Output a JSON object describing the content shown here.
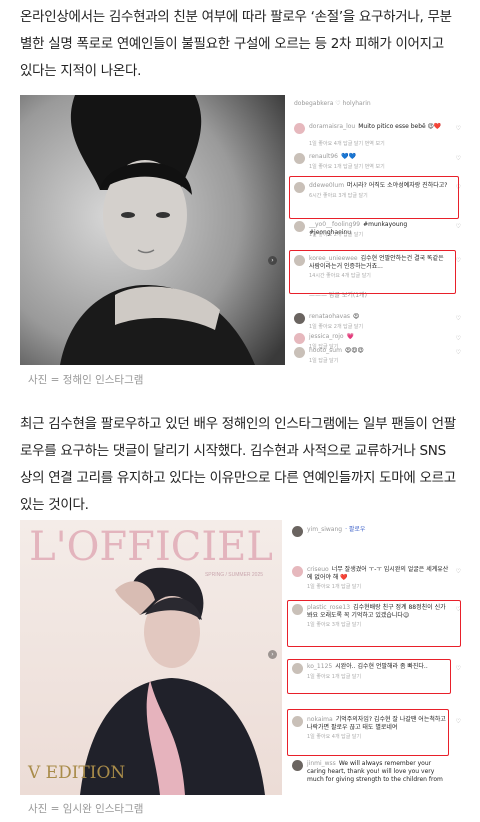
{
  "article": {
    "para1": "온라인상에서는 김수현과의 친분 여부에 따라 팔로우 ‘손절’을 요구하거나, 무분별한 실명 폭로로 연예인들이 불필요한 구설에 오르는 등 2차 피해가 이어지고 있다는 지적이 나온다.",
    "para2": "최근 김수현을 팔로우하고 있던 배우 정해인의 인스타그램에는 일부 팬들이 언팔로우를 요구하는 댓글이 달리기 시작했다. 김수현과 사적으로 교류하거나 SNS 상의 연결 고리를 유지하고 있다는 이유만으로 다른 연예인들까지 도마에 오르고 있는 것이다.",
    "caption1": "사진 = 정해인 인스타그램",
    "caption2": "사진 = 임시완 인스타그램"
  },
  "figure1": {
    "top_user": "dobegabkera ♡ holyharin",
    "comments": [
      {
        "user": "doramaisra_lou",
        "text": "Muito pitico esse bebê 😍❤️",
        "meta": "1일 좋아요 4개 답글 달기 번역 보기",
        "avatar": "pink",
        "highlight": false
      },
      {
        "user": "renault96",
        "text": "💙💙",
        "meta": "1일 좋아요 1개 답글 달기 번역 보기",
        "avatar": "light",
        "highlight": false
      },
      {
        "user": "ddewe0lum",
        "text": "머시라? 어직도 소야성예자랑 진하다고?",
        "meta": "6시간 좋아요 3개 답글 달기",
        "avatar": "light",
        "highlight": true
      },
      {
        "user": "__yo0__fooling99",
        "text": "#munkayoung #jeonghaeinu",
        "meta": "1일 좋아요 2개 답글 달기",
        "avatar": "light",
        "highlight": false
      },
      {
        "user": "koree_unieewee",
        "text": "김수현 언팔안하는건 결국 똑같은 사람이라는거 인증하는거죠...",
        "meta": "14시간 좋아요 4개 답글 달기",
        "avatar": "light",
        "highlight": true
      },
      {
        "user": "",
        "text": "——— 답글 보기(1개)",
        "meta": "",
        "avatar": "none",
        "highlight": false
      },
      {
        "user": "renataohavas",
        "text": "😍",
        "meta": "1일 좋아요 2개 답글 달기",
        "avatar": "dark",
        "highlight": false
      },
      {
        "user": "jessica_rojo",
        "text": "💗",
        "meta": "1일 답글 달기",
        "avatar": "pink",
        "highlight": false
      },
      {
        "user": "hooto_sum",
        "text": "😍😍😍",
        "meta": "1일 답글 달기",
        "avatar": "light",
        "highlight": false
      }
    ]
  },
  "figure2": {
    "magazine_title": "L'OFFICIEL",
    "magazine_sub": "SPRING / SUMMER 2025",
    "magazine_edition": "V EDITION",
    "top_user": "yim_siwang",
    "follow_label": "· 팔로우",
    "comments": [
      {
        "user": "criseuo",
        "text": "너무 잘생겼어 ㅜ-ㅜ 임시완의 얼굴은 세계유산에 없어야 해 ❤️",
        "meta": "1일 좋아요 1개 답글 달기",
        "avatar": "pink",
        "highlight": false
      },
      {
        "user": "plastic_rose13",
        "text": "김수현배랑 친구 정계 88정친이 신가봐요 오래도록 꼭 기억하고 있겠습니다😉",
        "meta": "1일 좋아요 3개 답글 달기",
        "avatar": "light",
        "highlight": true
      },
      {
        "user": "ko_1125",
        "text": "시완아.. 김수현 언팔해라 좀 빠진다..",
        "meta": "1일 좋아요 1개 답글 달기",
        "avatar": "light",
        "highlight": true
      },
      {
        "user": "nokaima",
        "text": "기억주의자임? 김수현 잘 나갈땐 어는척하고 나락가면 팔로우 끊고 태도 별로네여",
        "meta": "1일 좋아요 4개 답글 달기",
        "avatar": "light",
        "highlight": true
      },
      {
        "user": "jinmi_wss",
        "text": "We will always remember your caring heart, thank you! will love you very much for giving strength to the children from",
        "meta": "",
        "avatar": "dark",
        "highlight": false
      }
    ]
  }
}
